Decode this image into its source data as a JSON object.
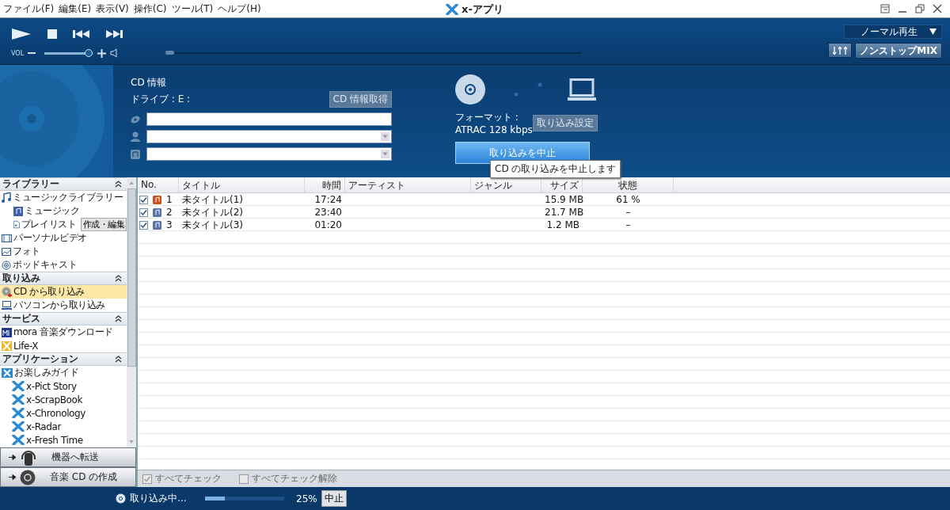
{
  "window": {
    "title": "x-アプリ"
  },
  "menu": [
    "ファイル(F)",
    "編集(E)",
    "表示(V)",
    "操作(C)",
    "ツール(T)",
    "ヘルプ(H)"
  ],
  "player": {
    "volume_label": "VOL",
    "volume": {
      "level": 0.9
    },
    "seek": {
      "level": 0.0
    },
    "play_mode": "ノーマル再生",
    "nonstop_button": "ノンストップMIX"
  },
  "cd_info": {
    "heading": "CD 情報",
    "drive": "ドライブ : E :",
    "fetch_button": "CD 情報取得",
    "fields": [
      {
        "kind": "album"
      },
      {
        "kind": "artist"
      },
      {
        "kind": "genre"
      }
    ],
    "format_label": "フォーマット :",
    "format_value": "ATRAC 128 kbps",
    "settings_button": "取り込み設定",
    "stop_button": "取り込みを中止",
    "tooltip": "CD の取り込みを中止します"
  },
  "sidebar": {
    "sections": [
      {
        "title": "ライブラリー",
        "expanded": true,
        "items": [
          {
            "label": "ミュージックライブラリー",
            "kind": "note",
            "selected": false,
            "children": [
              {
                "label": "ミュージック",
                "kind": "music",
                "selected": false
              },
              {
                "label": "プレイリスト",
                "kind": "playlist",
                "selected": false,
                "action": "作成・編集"
              }
            ]
          },
          {
            "label": "パーソナルビデオ",
            "kind": "film",
            "selected": false
          },
          {
            "label": "フォト",
            "kind": "photo",
            "selected": false
          },
          {
            "label": "ポッドキャスト",
            "kind": "podcast",
            "selected": false
          }
        ]
      },
      {
        "title": "取り込み",
        "expanded": true,
        "items": [
          {
            "label": "CD から取り込み",
            "kind": "cd",
            "selected": true
          },
          {
            "label": "パソコンから取り込み",
            "kind": "pc",
            "selected": false
          }
        ]
      },
      {
        "title": "サービス",
        "expanded": true,
        "items": [
          {
            "label": "mora 音楽ダウンロード",
            "kind": "mora",
            "selected": false
          },
          {
            "label": "Life-X",
            "kind": "lifex",
            "selected": false
          }
        ]
      },
      {
        "title": "アプリケーション",
        "expanded": true,
        "items": [
          {
            "label": "お楽しみガイド",
            "kind": "app",
            "selected": false,
            "children": [
              {
                "label": "x-Pict Story",
                "kind": "x",
                "selected": false
              },
              {
                "label": "x-ScrapBook",
                "kind": "x",
                "selected": false
              },
              {
                "label": "x-Chronology",
                "kind": "x",
                "selected": false
              },
              {
                "label": "x-Radar",
                "kind": "x",
                "selected": false
              },
              {
                "label": "x-Fresh Time",
                "kind": "x",
                "selected": false
              }
            ]
          }
        ]
      }
    ]
  },
  "side_buttons": [
    {
      "label": "機器へ転送",
      "kind": "device"
    },
    {
      "label": "音楽 CD の作成",
      "kind": "disc"
    }
  ],
  "table": {
    "columns": [
      "No.",
      "タイトル",
      "時間",
      "アーティスト",
      "ジャンル",
      "サイズ",
      "状態"
    ],
    "rows": [
      {
        "checked": true,
        "importing": true,
        "no": "1",
        "title": "未タイトル(1)",
        "time": "17:24",
        "size": "15.9 MB",
        "status": "61 %"
      },
      {
        "checked": true,
        "importing": false,
        "no": "2",
        "title": "未タイトル(2)",
        "time": "23:40",
        "size": "21.7 MB",
        "status": "–"
      },
      {
        "checked": true,
        "importing": false,
        "no": "3",
        "title": "未タイトル(3)",
        "time": "01:20",
        "size": "1.2 MB",
        "status": "–"
      }
    ]
  },
  "footer": [
    {
      "label": "すべてチェック",
      "disabled": true
    },
    {
      "label": "すべてチェック解除",
      "disabled": true
    }
  ],
  "status_bar": {
    "text": "取り込み中...",
    "progress": {
      "level": 0.25
    },
    "percent": "25%",
    "stop_button": "中止"
  }
}
